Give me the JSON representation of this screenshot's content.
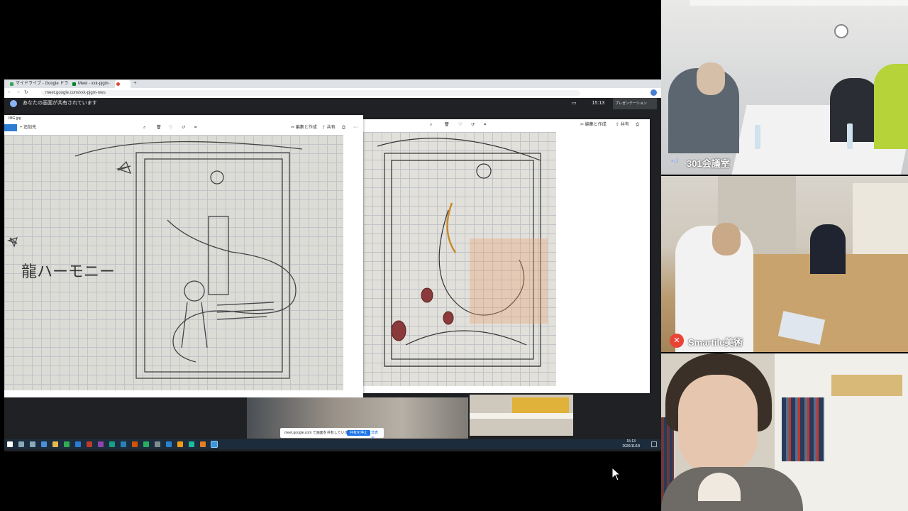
{
  "browser": {
    "tabs": [
      {
        "label": "マイドライブ - Google ドライブ"
      },
      {
        "label": "Meet - xxk-pjgm-nwu"
      },
      {
        "label": ""
      }
    ],
    "url": "meet.google.com/xxk-pjgm-nwu"
  },
  "meet": {
    "presenting_banner": "あなたの画面が共有されています",
    "clock": "15:13",
    "present_label": "プレゼンテーション"
  },
  "photos_left": {
    "title": "IMG.jpg",
    "add_to": "+ 追加先",
    "edit_create": "編集と作成",
    "share": "共有"
  },
  "photos_right": {
    "edit_create": "編集と作成",
    "share": "共有"
  },
  "sketch_left": {
    "caption": "龍ハーモニー"
  },
  "taskbar": {
    "time": "15:13",
    "date": "2020/11/18"
  },
  "toast": {
    "text": "meet.google.com で画面を共有しています。",
    "stop_button": "共有を停止",
    "hide_button": "非表示"
  },
  "participants": [
    {
      "name": "301会議室",
      "muted": false
    },
    {
      "name": "Smartile美術",
      "muted": true
    },
    {
      "name": "",
      "muted": false
    }
  ],
  "colors": {
    "meet_dark": "#202124",
    "mute_red": "#ea4335",
    "taskbar": "#1c2c3c"
  }
}
